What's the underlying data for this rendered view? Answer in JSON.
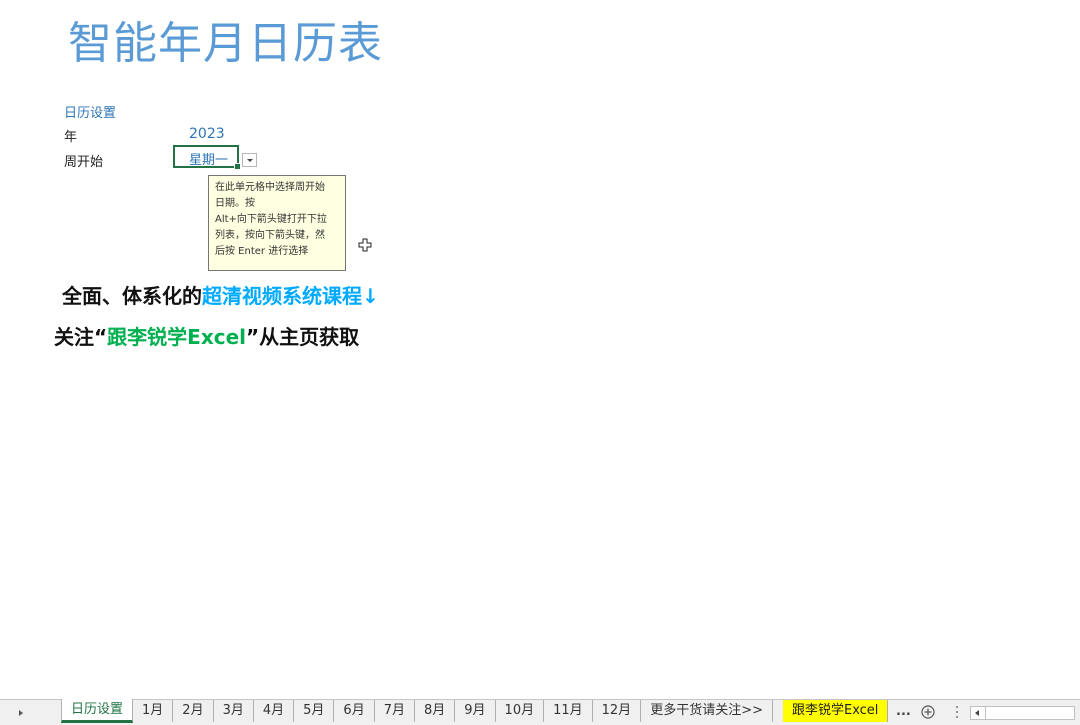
{
  "sheet": {
    "title": "智能年月日历表",
    "settings_label": "日历设置",
    "year_label": "年",
    "year_value": "2023",
    "week_start_label": "周开始",
    "week_start_value": "星期一",
    "tooltip_lines": [
      "在此单元格中选择周开始",
      "日期。按",
      "Alt+向下箭头键打开下拉",
      "列表，按向下箭头键，然",
      "后按 Enter 进行选择"
    ],
    "promo_line1_prefix": "全面、体系化的",
    "promo_line1_highlight": "超清视频系统课程↓",
    "promo_line2_prefix": "关注“",
    "promo_line2_highlight": "跟李锐学Excel",
    "promo_line2_suffix": "”从主页获取"
  },
  "tabs": {
    "items": [
      "日历设置",
      "1月",
      "2月",
      "3月",
      "4月",
      "5月",
      "6月",
      "7月",
      "8月",
      "9月",
      "10月",
      "11月",
      "12月",
      "更多干货请关注>>",
      "跟李锐学Excel"
    ],
    "active_index": 0,
    "highlight_index": 14,
    "more_label": "...",
    "icons": [
      "sheet-nav-right-icon",
      "add-sheet-icon",
      "split-handle-icon",
      "scroll-left-icon"
    ]
  },
  "colors": {
    "title": "#5b9bd5",
    "accent_green": "#217346",
    "highlight_blue": "#00aaff",
    "highlight_green": "#00b050",
    "tab_highlight": "#ffff00",
    "tooltip_bg": "#ffffe1"
  }
}
